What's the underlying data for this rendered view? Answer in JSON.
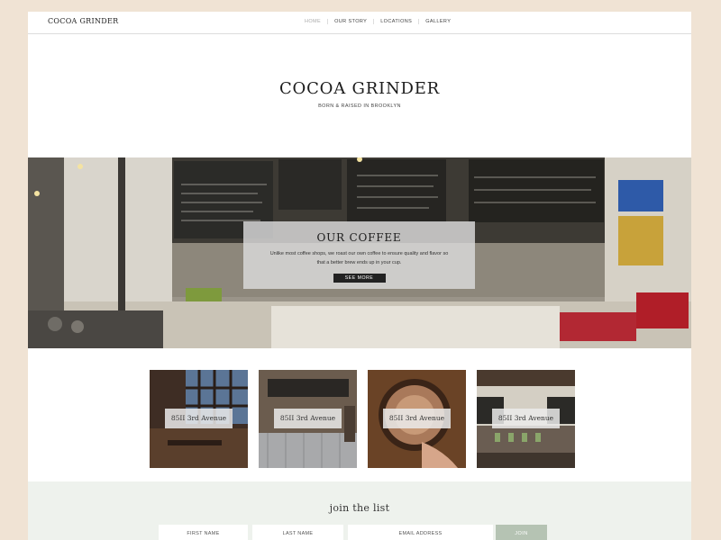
{
  "nav": {
    "brand": "COCOA GRINDER",
    "items": [
      {
        "label": "HOME",
        "active": true
      },
      {
        "label": "OUR STORY",
        "active": false
      },
      {
        "label": "LOCATIONS",
        "active": false
      },
      {
        "label": "GALLERY",
        "active": false
      }
    ]
  },
  "hero": {
    "title": "COCOA GRINDER",
    "subtitle": "BORN & RAISED IN BROOKLYN"
  },
  "coffee": {
    "title": "OUR COFFEE",
    "text": "Unlike most coffee shops, we roast our own coffee to ensure quality and flavor so that a better brew ends up in your cup.",
    "button": "SEE MORE"
  },
  "locations": [
    {
      "label": "85II 3rd Avenue"
    },
    {
      "label": "85II 3rd Avenue"
    },
    {
      "label": "85II 3rd Avenue"
    },
    {
      "label": "85II 3rd Avenue"
    }
  ],
  "signup": {
    "title": "join the list",
    "first_name": "FIRST NAME",
    "last_name": "LAST NAME",
    "email": "EMAIL ADDRESS",
    "join": "JOIN"
  },
  "colors": {
    "background": "#f0e3d4",
    "signup_bg": "#eef2ed",
    "join_button": "#b5c3b3"
  }
}
